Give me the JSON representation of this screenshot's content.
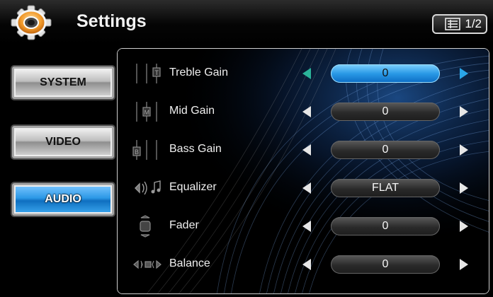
{
  "header": {
    "title": "Settings",
    "page_indicator": "1/2"
  },
  "sidebar": {
    "items": [
      {
        "label": "SYSTEM",
        "active": false
      },
      {
        "label": "VIDEO",
        "active": false
      },
      {
        "label": "AUDIO",
        "active": true
      }
    ]
  },
  "audio": {
    "rows": [
      {
        "label": "Treble Gain",
        "value": "0",
        "icon": "treble-gain-icon",
        "selected": true
      },
      {
        "label": "Mid Gain",
        "value": "0",
        "icon": "mid-gain-icon",
        "selected": false
      },
      {
        "label": "Bass Gain",
        "value": "0",
        "icon": "bass-gain-icon",
        "selected": false
      },
      {
        "label": "Equalizer",
        "value": "FLAT",
        "icon": "equalizer-icon",
        "selected": false
      },
      {
        "label": "Fader",
        "value": "0",
        "icon": "fader-icon",
        "selected": false
      },
      {
        "label": "Balance",
        "value": "0",
        "icon": "balance-icon",
        "selected": false
      }
    ]
  },
  "colors": {
    "accent": "#2a9ae6",
    "left_arrow_highlight": "#2bb39a"
  }
}
